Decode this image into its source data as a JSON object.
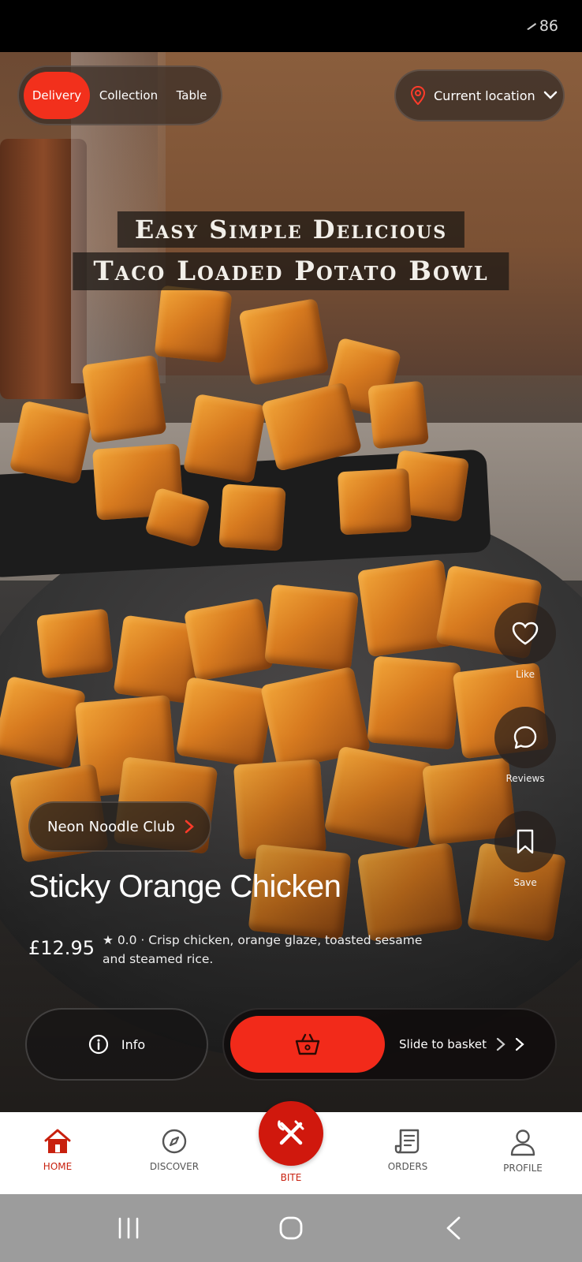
{
  "status_bar": {
    "battery_level": "86",
    "icon": "battery-icon"
  },
  "video": {
    "overlay_line_1": "Easy Simple Delicious",
    "overlay_line_2": "Taco Loaded Potato Bowl"
  },
  "mode_selector": {
    "options": [
      "Delivery",
      "Collection",
      "Table"
    ],
    "selected": "Delivery",
    "accent_color": "#F2301C"
  },
  "location": {
    "label": "Current location",
    "icon": "location-pin-icon"
  },
  "actions": {
    "like": {
      "label": "Like",
      "icon": "heart-icon"
    },
    "reviews": {
      "label": "Reviews",
      "icon": "chat-bubble-icon"
    },
    "save": {
      "label": "Save",
      "icon": "bookmark-icon"
    }
  },
  "restaurant": {
    "name": "Neon Noodle Club"
  },
  "dish": {
    "title": "Sticky Orange Chicken",
    "price": "£12.95",
    "description": "★ 0.0 · Crisp chicken, orange glaze, toasted sesame and steamed rice."
  },
  "buttons": {
    "info_label": "Info",
    "slide_label": "Slide to basket"
  },
  "bottom_nav": {
    "home": "HOME",
    "discover": "DISCOVER",
    "bite": "BITE",
    "orders": "ORDERS",
    "profile": "PROFILE",
    "active": "HOME",
    "active_color": "#C8200E"
  }
}
